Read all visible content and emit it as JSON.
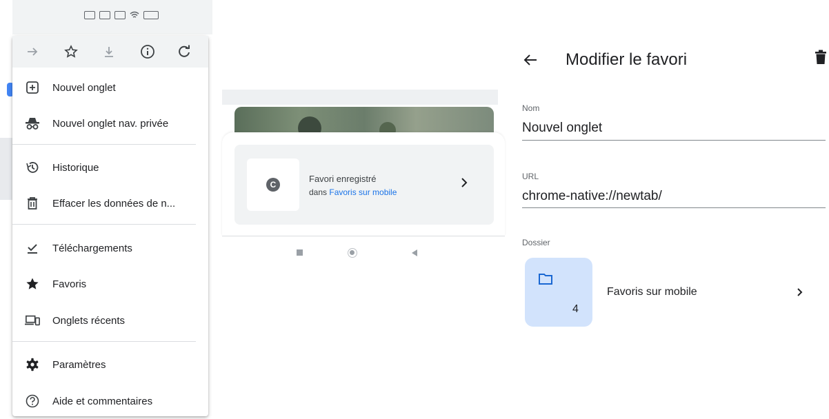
{
  "left_panel": {
    "toolbar": {
      "forward_icon": "arrow-forward-icon",
      "bookmark_icon": "star-outline-icon",
      "download_icon": "download-icon",
      "info_icon": "info-icon",
      "reload_icon": "reload-icon"
    },
    "menu": {
      "items": [
        {
          "label": "Nouvel onglet",
          "icon": "plus-box-icon"
        },
        {
          "label": "Nouvel onglet nav. privée",
          "icon": "incognito-icon"
        },
        {
          "label": "Historique",
          "icon": "history-icon"
        },
        {
          "label": "Effacer les données de n...",
          "icon": "trash-icon"
        },
        {
          "label": "Téléchargements",
          "icon": "download-done-icon"
        },
        {
          "label": "Favoris",
          "icon": "star-filled-icon"
        },
        {
          "label": "Onglets récents",
          "icon": "devices-icon"
        },
        {
          "label": "Paramètres",
          "icon": "gear-icon"
        },
        {
          "label": "Aide et commentaires",
          "icon": "help-icon"
        }
      ]
    }
  },
  "middle_panel": {
    "snackbar": {
      "favicon_letter": "C",
      "line1": "Favori enregistré",
      "line2_prefix": "dans ",
      "line2_link": "Favoris sur mobile"
    },
    "navbar": {
      "icons": [
        "recents-square-icon",
        "home-circle-icon",
        "back-triangle-icon"
      ]
    }
  },
  "right_panel": {
    "title": "Modifier le favori",
    "fields": {
      "name_label": "Nom",
      "name_value": "Nouvel onglet",
      "url_label": "URL",
      "url_value": "chrome-native://newtab/",
      "folder_label": "Dossier"
    },
    "folder": {
      "count": "4",
      "name": "Favoris sur mobile"
    }
  },
  "colors": {
    "accent": "#1a73e8",
    "folder_tile": "#d2e3fc",
    "toolbar_bg": "#f1f3f4"
  }
}
